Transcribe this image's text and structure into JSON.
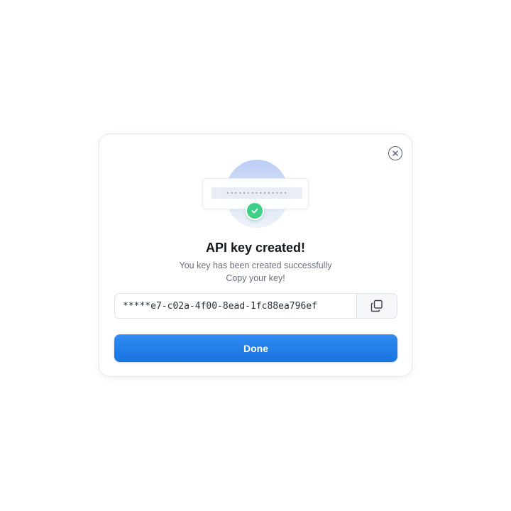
{
  "dialog": {
    "title": "API key created!",
    "subtitle_line1": "You key has been created successfully",
    "subtitle_line2": "Copy your key!",
    "close_icon": "close-icon"
  },
  "illustration": {
    "masked_key": "•••••••••••••••",
    "check_icon": "check-icon"
  },
  "api_key": {
    "value": "*****e7-c02a-4f00-8ead-1fc88ea796ef",
    "copy_icon": "copy-icon"
  },
  "actions": {
    "done_label": "Done"
  },
  "colors": {
    "primary": "#1a72e0",
    "success": "#3ecf86"
  }
}
